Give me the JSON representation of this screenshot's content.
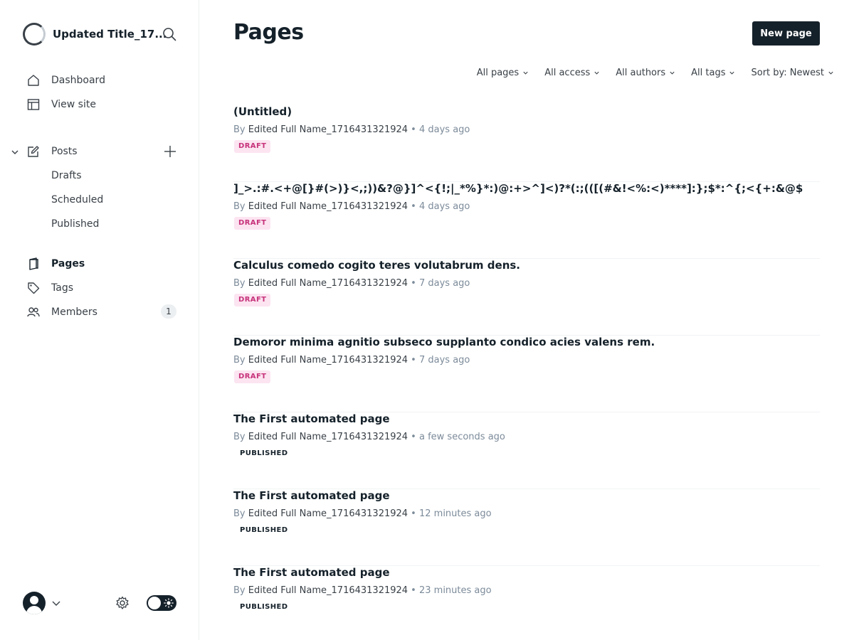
{
  "sidebar": {
    "site_title": "Updated Title_17...",
    "nav": {
      "dashboard": "Dashboard",
      "view_site": "View site",
      "posts": "Posts",
      "drafts": "Drafts",
      "scheduled": "Scheduled",
      "published": "Published",
      "pages": "Pages",
      "tags": "Tags",
      "members": "Members",
      "members_count": "1"
    },
    "icons": [
      "search-icon",
      "home-icon",
      "view-site-icon",
      "chevron-down-icon",
      "posts-icon",
      "plus-icon",
      "pages-icon",
      "tags-icon",
      "members-icon",
      "gear-icon",
      "sun-icon"
    ]
  },
  "main": {
    "title": "Pages",
    "new_page_label": "New page",
    "filters": [
      "All pages",
      "All access",
      "All authors",
      "All tags",
      "Sort by: Newest"
    ],
    "pages": [
      {
        "title": "(Untitled)",
        "author": "Edited Full Name_1716431321924",
        "age": "4 days ago",
        "status": "DRAFT"
      },
      {
        "title": "]_>.:#.<+@[}#(>)}<,;))&?@}]^<{!;|_*%}*:)@:+>^]<)?*(:;(([(#&!<%:<)****]:};$*:^{;<{+:&@$,>#.{]_}%${&.[",
        "author": "Edited Full Name_1716431321924",
        "age": "4 days ago",
        "status": "DRAFT"
      },
      {
        "title": "Calculus comedo cogito teres volutabrum dens.",
        "author": "Edited Full Name_1716431321924",
        "age": "7 days ago",
        "status": "DRAFT"
      },
      {
        "title": "Demoror minima agnitio subseco supplanto condico acies valens rem.",
        "author": "Edited Full Name_1716431321924",
        "age": "7 days ago",
        "status": "DRAFT"
      },
      {
        "title": "The First automated page",
        "author": "Edited Full Name_1716431321924",
        "age": "a few seconds ago",
        "status": "PUBLISHED"
      },
      {
        "title": "The First automated page",
        "author": "Edited Full Name_1716431321924",
        "age": "12 minutes ago",
        "status": "PUBLISHED"
      },
      {
        "title": "The First automated page",
        "author": "Edited Full Name_1716431321924",
        "age": "23 minutes ago",
        "status": "PUBLISHED"
      }
    ]
  },
  "colors": {
    "text": "#15212a",
    "muted": "#7c8b9a",
    "draft_badge_bg": "#fce4f1",
    "draft_badge_fg": "#c7337b",
    "button_bg": "#15212a"
  }
}
